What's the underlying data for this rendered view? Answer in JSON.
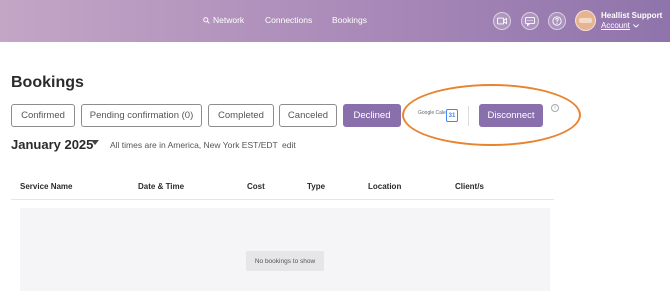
{
  "header": {
    "nav": [
      {
        "label": "Network",
        "icon": "search-icon"
      },
      {
        "label": "Connections"
      },
      {
        "label": "Bookings"
      }
    ],
    "icons": [
      "video-icon",
      "chat-icon",
      "help-icon"
    ],
    "user": {
      "name": "Heallist Support",
      "account_label": "Account"
    },
    "gradient_colors": [
      "#c3a6c6",
      "#8f74ab"
    ]
  },
  "main": {
    "title": "Bookings",
    "tabs": [
      {
        "label": "Confirmed",
        "active": false
      },
      {
        "label": "Pending confirmation (0)",
        "active": false
      },
      {
        "label": "Completed",
        "active": false
      },
      {
        "label": "Canceled",
        "active": false
      },
      {
        "label": "Declined",
        "active": true
      }
    ],
    "calendar": {
      "provider_label": "Google Calendar",
      "icon_text": "31",
      "disconnect_label": "Disconnect",
      "info_icon_text": "i"
    },
    "month": "January 2025",
    "timezone_note": "All times are in America, New York EST/EDT",
    "edit_label": "edit",
    "table": {
      "columns": [
        "Service Name",
        "Date & Time",
        "Cost",
        "Type",
        "Location",
        "Client/s"
      ],
      "rows": [],
      "empty_message": "No bookings to show"
    }
  },
  "colors": {
    "accent": "#8a6fad",
    "highlight": "#e8832f"
  }
}
